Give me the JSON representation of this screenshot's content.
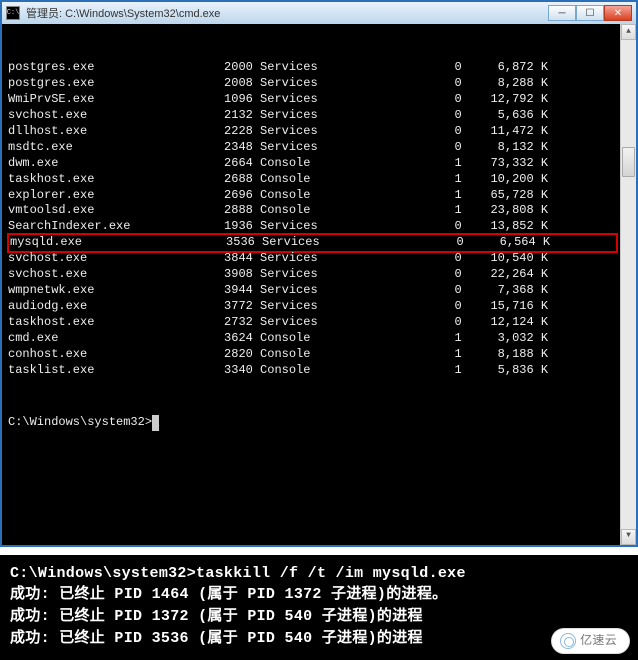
{
  "window": {
    "icon_text": "C:\\",
    "title": "管理员: C:\\Windows\\System32\\cmd.exe"
  },
  "processes": [
    {
      "name": "postgres.exe",
      "pid": "2000",
      "session": "Services",
      "snum": "0",
      "mem": "6,872 K",
      "highlight": false
    },
    {
      "name": "postgres.exe",
      "pid": "2008",
      "session": "Services",
      "snum": "0",
      "mem": "8,288 K",
      "highlight": false
    },
    {
      "name": "WmiPrvSE.exe",
      "pid": "1096",
      "session": "Services",
      "snum": "0",
      "mem": "12,792 K",
      "highlight": false
    },
    {
      "name": "svchost.exe",
      "pid": "2132",
      "session": "Services",
      "snum": "0",
      "mem": "5,636 K",
      "highlight": false
    },
    {
      "name": "dllhost.exe",
      "pid": "2228",
      "session": "Services",
      "snum": "0",
      "mem": "11,472 K",
      "highlight": false
    },
    {
      "name": "msdtc.exe",
      "pid": "2348",
      "session": "Services",
      "snum": "0",
      "mem": "8,132 K",
      "highlight": false
    },
    {
      "name": "dwm.exe",
      "pid": "2664",
      "session": "Console",
      "snum": "1",
      "mem": "73,332 K",
      "highlight": false
    },
    {
      "name": "taskhost.exe",
      "pid": "2688",
      "session": "Console",
      "snum": "1",
      "mem": "10,200 K",
      "highlight": false
    },
    {
      "name": "explorer.exe",
      "pid": "2696",
      "session": "Console",
      "snum": "1",
      "mem": "65,728 K",
      "highlight": false
    },
    {
      "name": "vmtoolsd.exe",
      "pid": "2888",
      "session": "Console",
      "snum": "1",
      "mem": "23,808 K",
      "highlight": false
    },
    {
      "name": "SearchIndexer.exe",
      "pid": "1936",
      "session": "Services",
      "snum": "0",
      "mem": "13,852 K",
      "highlight": false
    },
    {
      "name": "mysqld.exe",
      "pid": "3536",
      "session": "Services",
      "snum": "0",
      "mem": "6,564 K",
      "highlight": true
    },
    {
      "name": "svchost.exe",
      "pid": "3844",
      "session": "Services",
      "snum": "0",
      "mem": "10,540 K",
      "highlight": false
    },
    {
      "name": "svchost.exe",
      "pid": "3908",
      "session": "Services",
      "snum": "0",
      "mem": "22,264 K",
      "highlight": false
    },
    {
      "name": "wmpnetwk.exe",
      "pid": "3944",
      "session": "Services",
      "snum": "0",
      "mem": "7,368 K",
      "highlight": false
    },
    {
      "name": "audiodg.exe",
      "pid": "3772",
      "session": "Services",
      "snum": "0",
      "mem": "15,716 K",
      "highlight": false
    },
    {
      "name": "taskhost.exe",
      "pid": "2732",
      "session": "Services",
      "snum": "0",
      "mem": "12,124 K",
      "highlight": false
    },
    {
      "name": "cmd.exe",
      "pid": "3624",
      "session": "Console",
      "snum": "1",
      "mem": "3,032 K",
      "highlight": false
    },
    {
      "name": "conhost.exe",
      "pid": "2820",
      "session": "Console",
      "snum": "1",
      "mem": "8,188 K",
      "highlight": false
    },
    {
      "name": "tasklist.exe",
      "pid": "3340",
      "session": "Console",
      "snum": "1",
      "mem": "5,836 K",
      "highlight": false
    }
  ],
  "prompt": "C:\\Windows\\system32>",
  "second": {
    "prompt": "C:\\Windows\\system32>",
    "command": "taskkill /f /t /im mysqld.exe",
    "lines": [
      "成功: 已终止 PID 1464 (属于 PID 1372 子进程)的进程。",
      "成功: 已终止 PID 1372 (属于 PID 540 子进程)的进程",
      "成功: 已终止 PID 3536 (属于 PID 540 子进程)的进程"
    ]
  },
  "watermark": "亿速云",
  "col_widths": {
    "name": 26,
    "pid": 8,
    "session": 16,
    "snum": 12,
    "mem": 12
  }
}
